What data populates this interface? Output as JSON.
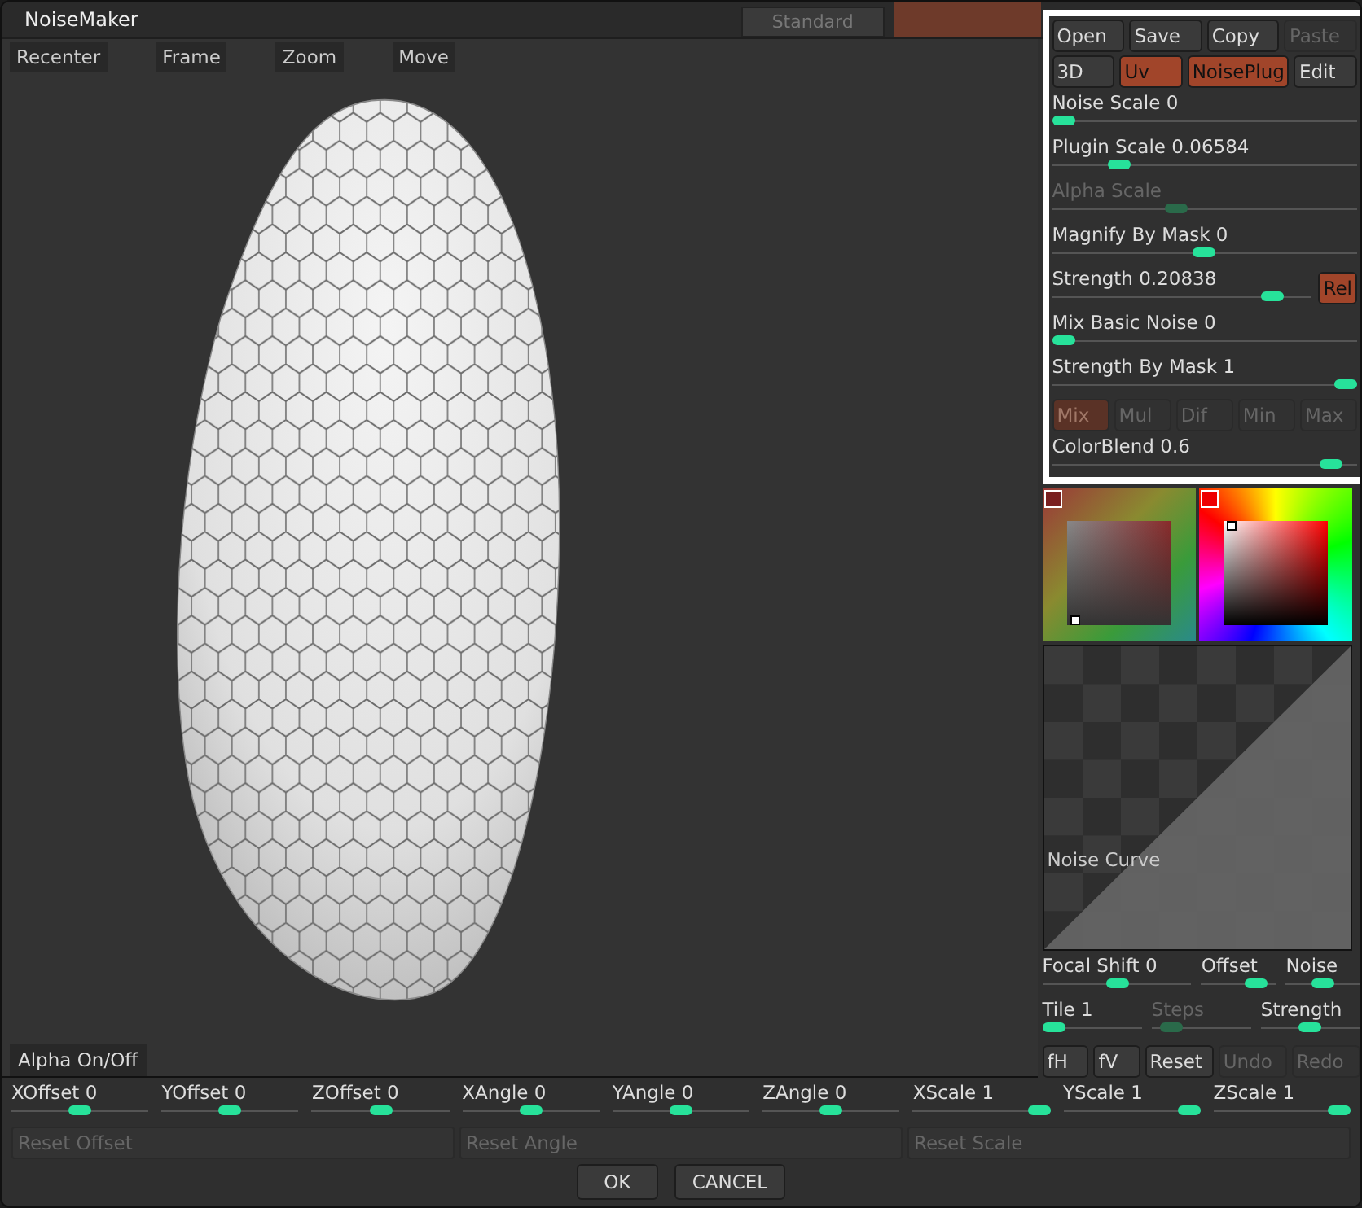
{
  "window": {
    "title": "NoiseMaker",
    "background_tab": "Standard"
  },
  "toolbar": [
    {
      "label": "Recenter"
    },
    {
      "label": "Frame"
    },
    {
      "label": "Zoom"
    },
    {
      "label": "Move"
    }
  ],
  "file_buttons": [
    {
      "label": "Open",
      "disabled": false
    },
    {
      "label": "Save",
      "disabled": false
    },
    {
      "label": "Copy",
      "disabled": false
    },
    {
      "label": "Paste",
      "disabled": true
    }
  ],
  "mode_buttons": [
    {
      "label": "3D",
      "active": false
    },
    {
      "label": "Uv",
      "active": true
    },
    {
      "label": "NoisePlug",
      "active": true
    },
    {
      "label": "Edit",
      "active": false
    }
  ],
  "sliders": [
    {
      "kind": "slider",
      "label": "Noise Scale",
      "value": "0",
      "level": 0,
      "disabled": false
    },
    {
      "kind": "slider",
      "label": "Plugin Scale",
      "value": "0.06584",
      "level": 0.2,
      "disabled": false
    },
    {
      "kind": "slider",
      "label": "Alpha Scale",
      "level": 0.4,
      "disabled": true
    },
    {
      "kind": "slider",
      "label": "Magnify By Mask",
      "value": "0",
      "level": 0.5,
      "disabled": false
    },
    {
      "kind": "slider_button",
      "label": "Strength",
      "value": "0.20838",
      "level": 0.88,
      "disabled": false,
      "button": {
        "label": "Rel",
        "active": true
      }
    },
    {
      "kind": "slider",
      "label": "Mix Basic Noise",
      "value": "0",
      "level": 0,
      "disabled": false
    },
    {
      "kind": "slider",
      "label": "Strength By Mask",
      "value": "1",
      "level": 1,
      "disabled": false
    },
    {
      "kind": "blend",
      "buttons": [
        {
          "label": "Mix",
          "selected": true
        },
        {
          "label": "Mul",
          "selected": false
        },
        {
          "label": "Dif",
          "selected": false
        },
        {
          "label": "Min",
          "selected": false
        },
        {
          "label": "Max",
          "selected": false
        }
      ],
      "disabled": true
    },
    {
      "kind": "slider",
      "label": "ColorBlend",
      "value": "0.6",
      "level": 0.95,
      "disabled": false
    }
  ],
  "curve": {
    "label": "Noise Curve"
  },
  "curve_sliders": [
    [
      {
        "label": "Focal Shift",
        "value": "0",
        "level": 0.5,
        "disabled": false
      },
      {
        "label": "Offset",
        "level": 0.85,
        "disabled": false
      },
      {
        "label": "Noise",
        "level": 0.5,
        "disabled": false
      }
    ],
    [
      {
        "label": "Tile",
        "value": "1",
        "level": 0,
        "disabled": false
      },
      {
        "label": "Steps",
        "level": 0.1,
        "disabled": true
      },
      {
        "label": "Strength",
        "level": 0.5,
        "disabled": false
      }
    ]
  ],
  "curve_buttons": [
    {
      "label": "fH",
      "disabled": false
    },
    {
      "label": "fV",
      "disabled": false
    },
    {
      "label": "Reset",
      "disabled": false
    },
    {
      "label": "Undo",
      "disabled": true
    },
    {
      "label": "Redo",
      "disabled": true
    }
  ],
  "alpha_toggle": {
    "label": "Alpha On/Off"
  },
  "transform_sliders": [
    {
      "label": "XOffset",
      "value": "0",
      "level": 0.5
    },
    {
      "label": "YOffset",
      "value": "0",
      "level": 0.5
    },
    {
      "label": "ZOffset",
      "value": "0",
      "level": 0.5
    },
    {
      "label": "XAngle",
      "value": "0",
      "level": 0.5
    },
    {
      "label": "YAngle",
      "value": "0",
      "level": 0.5
    },
    {
      "label": "ZAngle",
      "value": "0",
      "level": 0.5
    },
    {
      "label": "XScale",
      "value": "1",
      "level": 1
    },
    {
      "label": "YScale",
      "value": "1",
      "level": 1
    },
    {
      "label": "ZScale",
      "value": "1",
      "level": 1
    }
  ],
  "reset_buttons": [
    {
      "label": "Reset Offset",
      "disabled": true
    },
    {
      "label": "Reset Angle",
      "disabled": true
    },
    {
      "label": "Reset Scale",
      "disabled": true
    }
  ],
  "dialog_buttons": [
    {
      "label": "OK"
    },
    {
      "label": "CANCEL"
    }
  ]
}
